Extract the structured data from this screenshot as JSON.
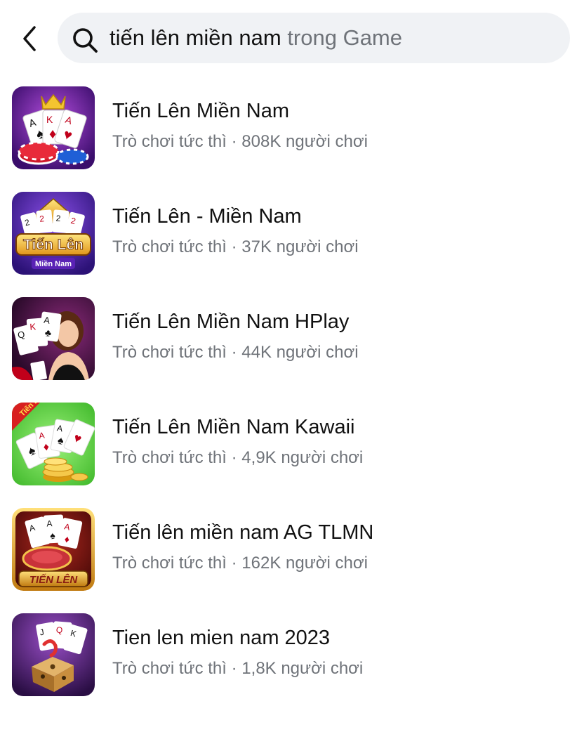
{
  "header": {
    "back_icon": "chevron-left-icon",
    "search_icon": "search-icon",
    "query": "tiến lên miền nam",
    "scope": "trong Game"
  },
  "results": [
    {
      "title": "Tiến Lên Miền Nam",
      "category": "Trò chơi tức thì",
      "separator": "·",
      "players": "808K người chơi",
      "icon": "cards-crown-chips-game-icon"
    },
    {
      "title": "Tiến Lên - Miền Nam",
      "category": "Trò chơi tức thì",
      "separator": "·",
      "players": "37K người chơi",
      "icon": "tien-len-logo-game-icon",
      "icon_text": "Tiến Lên",
      "icon_subtext": "Miền Nam"
    },
    {
      "title": "Tiến Lên Miền Nam HPlay",
      "category": "Trò chơi tức thì",
      "separator": "·",
      "players": "44K người chơi",
      "icon": "cards-woman-game-icon"
    },
    {
      "title": "Tiến Lên Miền Nam Kawaii",
      "category": "Trò chơi tức thì",
      "separator": "·",
      "players": "4,9K người chơi",
      "icon": "cards-coins-green-game-icon",
      "icon_text": "Tiến Lên"
    },
    {
      "title": "Tiến lên miền nam AG TLMN",
      "category": "Trò chơi tức thì",
      "separator": "·",
      "players": "162K người chơi",
      "icon": "cards-chip-gold-game-icon",
      "icon_text": "TIẾN LÊN"
    },
    {
      "title": "Tien len mien nam 2023",
      "category": "Trò chơi tức thì",
      "separator": "·",
      "players": "1,8K người chơi",
      "icon": "cards-dice-purple-game-icon"
    }
  ]
}
